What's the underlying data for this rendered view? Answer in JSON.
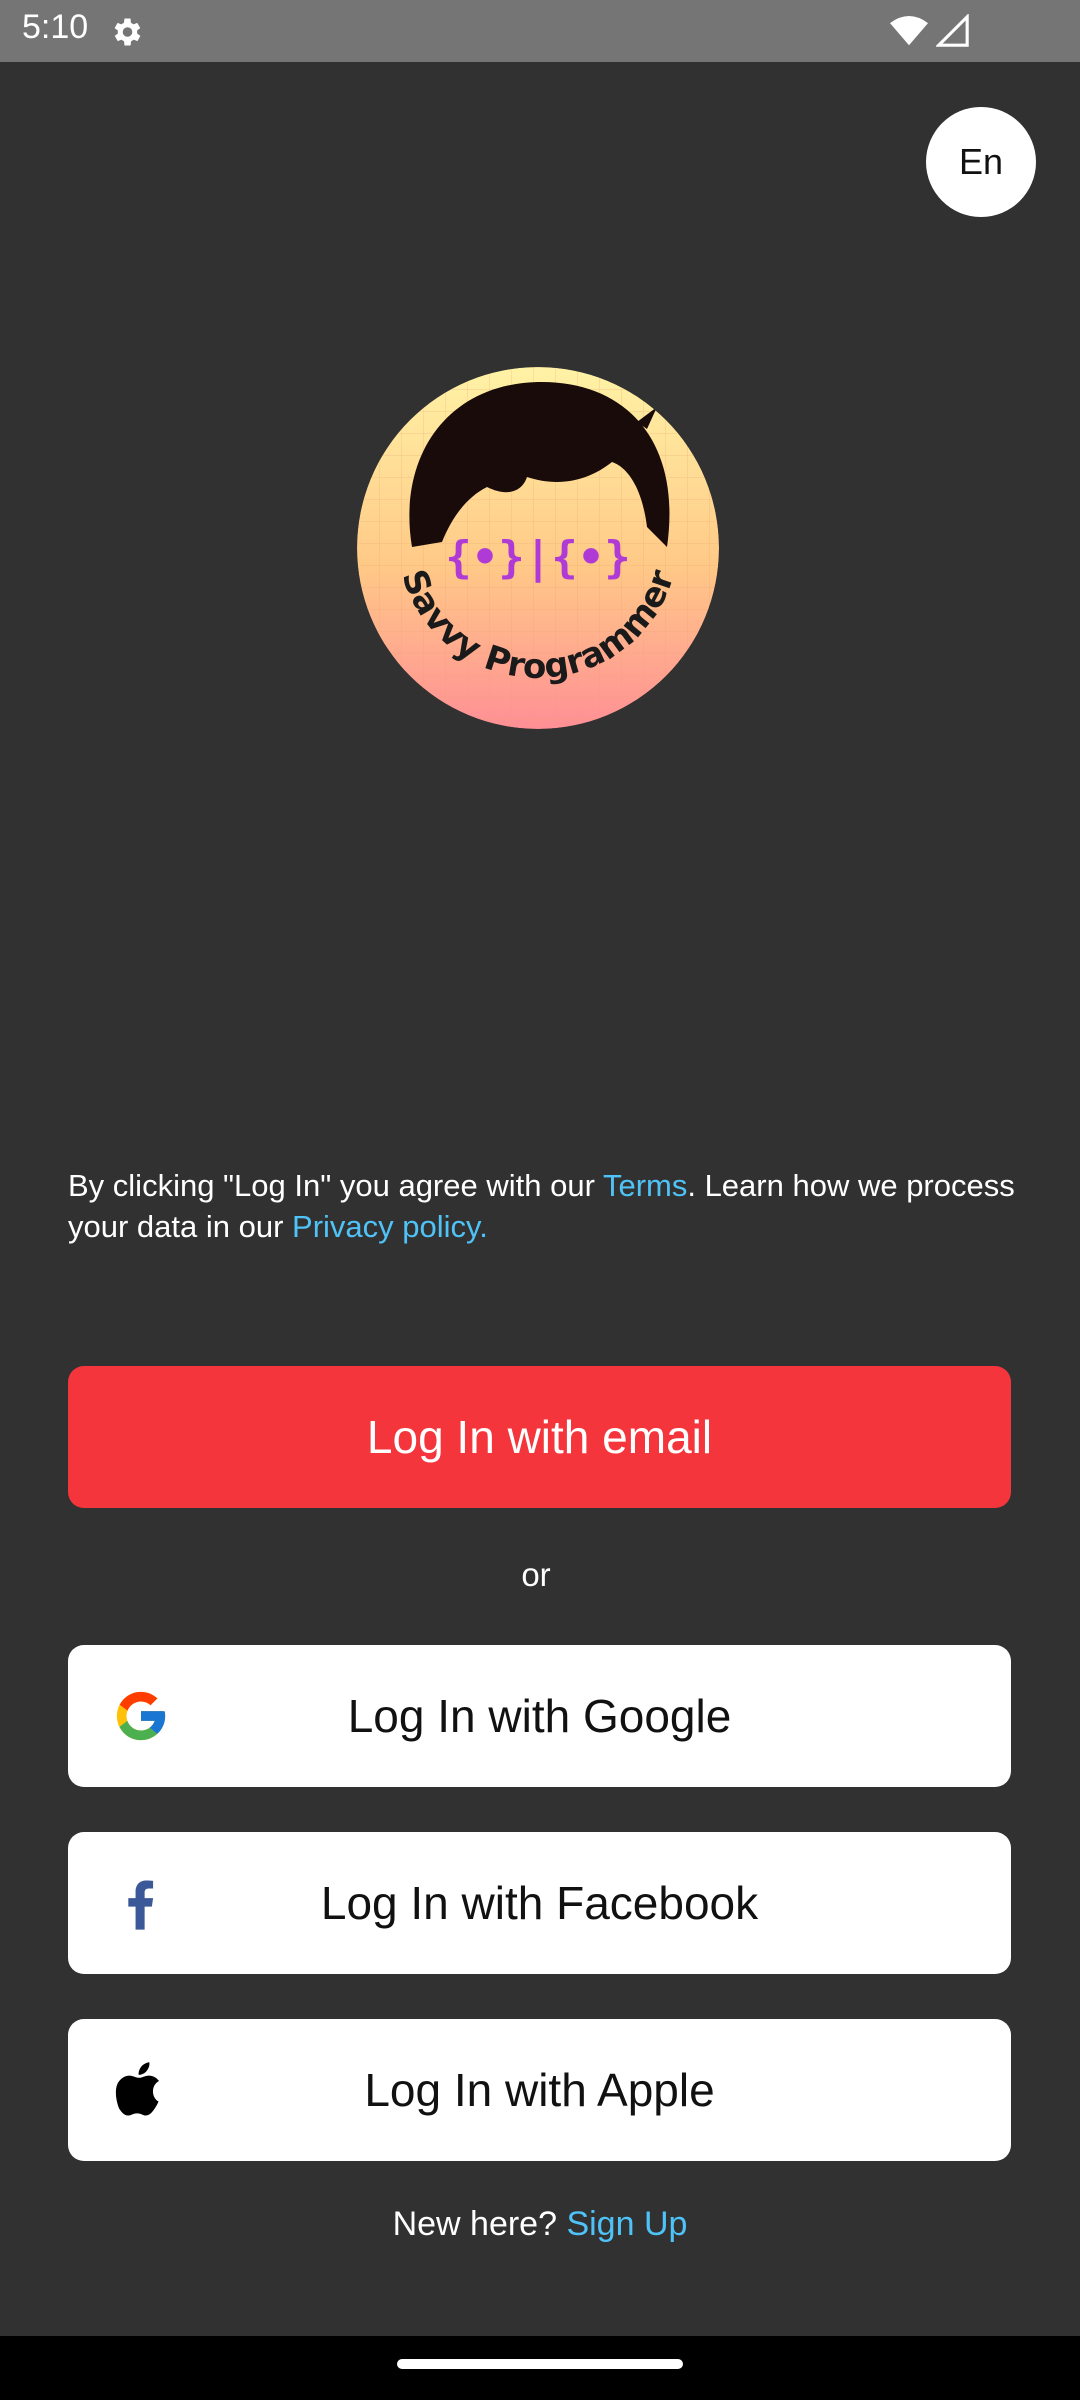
{
  "status_bar": {
    "time": "5:10"
  },
  "lang_button": {
    "label": "En"
  },
  "logo": {
    "text": "Savvy Programmer",
    "face_glyphs": "{•}|{•}"
  },
  "legal": {
    "prefix": "By clicking \"Log In\" you agree with our ",
    "terms_link": "Terms",
    "middle": ". Learn how we process your data in our ",
    "privacy_link": "Privacy policy."
  },
  "buttons": {
    "email": "Log In with email",
    "or": "or",
    "google": "Log In with Google",
    "facebook": "Log In with Facebook",
    "apple": "Log In with Apple"
  },
  "signup": {
    "prompt": "New here?",
    "link": "Sign Up"
  },
  "colors": {
    "background": "#313131",
    "primary_red": "#f4363c",
    "link_blue": "#4fc3f7",
    "status_bar": "#757575"
  }
}
